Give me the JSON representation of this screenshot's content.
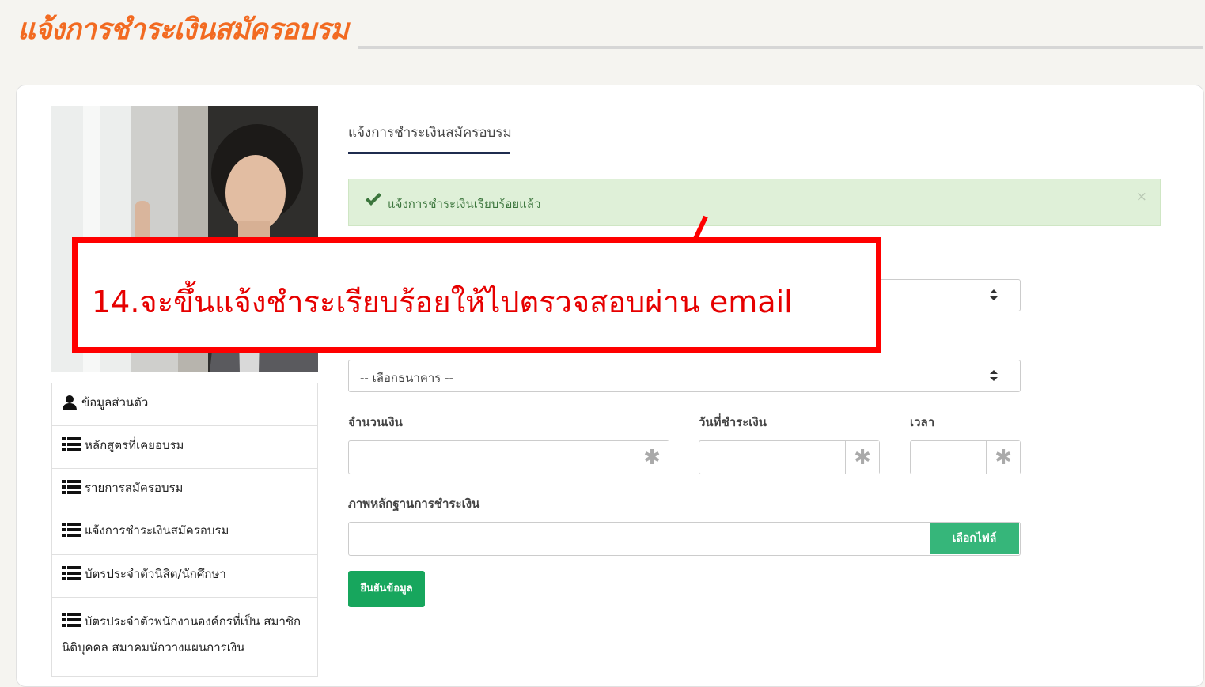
{
  "page": {
    "title": "แจ้งการชำระเงินสมัครอบรม"
  },
  "profile": {
    "photo_alt": "รูปโปรไฟล์"
  },
  "side_menu": [
    {
      "label": "ข้อมูลส่วนตัว",
      "icon": "user-icon"
    },
    {
      "label": "หลักสูตรที่เคยอบรม",
      "icon": "list-icon"
    },
    {
      "label": "รายการสมัครอบรม",
      "icon": "list-icon"
    },
    {
      "label": "แจ้งการชำระเงินสมัครอบรม",
      "icon": "list-icon"
    },
    {
      "label": "บัตรประจำตัวนิสิต/นักศึกษา",
      "icon": "list-icon"
    },
    {
      "label": "บัตรประจำตัวพนักงานองค์กรที่เป็น สมาชิกนิติบุคคล สมาคมนักวางแผนการเงิน",
      "icon": "list-icon"
    }
  ],
  "tab": {
    "label": "แจ้งการชำระเงินสมัครอบรม"
  },
  "alert": {
    "message": "แจ้งการชำระเงินเรียบร้อยแล้ว",
    "close": "×",
    "icon": "check-icon",
    "color": "#3c763d"
  },
  "form": {
    "bank_select": "-- เลือกธนาคาร --",
    "amount_label": "จำนวนเงิน",
    "date_label": "วันที่ชำระเงิน",
    "time_label": "เวลา",
    "required_marker": "✱",
    "evidence_label": "ภาพหลักฐานการชำระเงิน",
    "file_button": "เลือกไฟล์",
    "submit_button": "ยืนยันข้อมูล"
  },
  "annotation": {
    "text": "14.จะขึ้นแจ้งชำระเรียบร้อยให้ไปตรวจสอบผ่าน email",
    "color": "#ff0000"
  },
  "colors": {
    "brand_orange": "#f26a21",
    "success_green": "#17a65d",
    "tab_navy": "#1f2c4f"
  }
}
